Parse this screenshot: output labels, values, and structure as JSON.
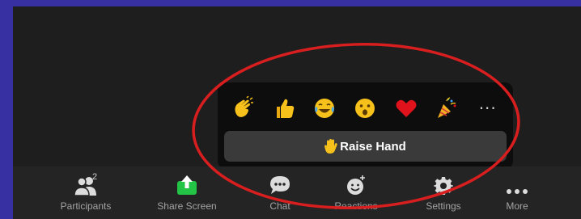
{
  "reactions": {
    "emojis": [
      {
        "name": "clapping-hands",
        "glyph": "👏"
      },
      {
        "name": "thumbs-up",
        "glyph": "👍"
      },
      {
        "name": "tears-of-joy",
        "glyph": "😂"
      },
      {
        "name": "open-mouth",
        "glyph": "😮"
      },
      {
        "name": "red-heart",
        "glyph": "❤"
      },
      {
        "name": "party-popper",
        "glyph": "🎉"
      }
    ],
    "more_glyph": "···",
    "raise_hand_label": "Raise Hand"
  },
  "toolbar": {
    "participants": {
      "label": "Participants",
      "count": "2"
    },
    "share_screen": {
      "label": "Share Screen",
      "accent": "#23c346"
    },
    "chat": {
      "label": "Chat"
    },
    "reactions": {
      "label": "Reactions"
    },
    "settings": {
      "label": "Settings"
    },
    "more": {
      "label": "More"
    }
  },
  "colors": {
    "annotation": "#d81e1e",
    "emoji_yellow": "#f7c11c",
    "heart": "#e0121b"
  }
}
